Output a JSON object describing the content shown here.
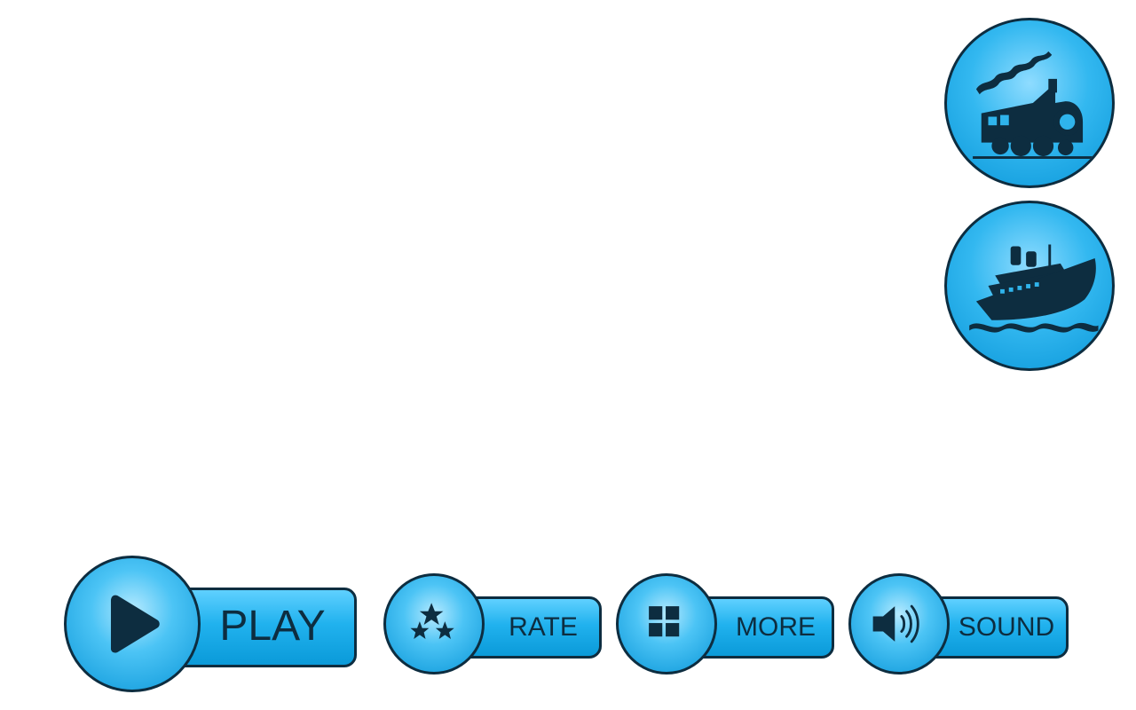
{
  "side_buttons": [
    {
      "icon": "steam-train-icon"
    },
    {
      "icon": "ship-icon"
    }
  ],
  "menu": {
    "play_label": "PLAY",
    "rate_label": "RATE",
    "more_label": "MORE",
    "sound_label": "SOUND"
  },
  "colors": {
    "accent": "#1bb0ee",
    "outline": "#0d2d40",
    "background": "#ffffff"
  }
}
